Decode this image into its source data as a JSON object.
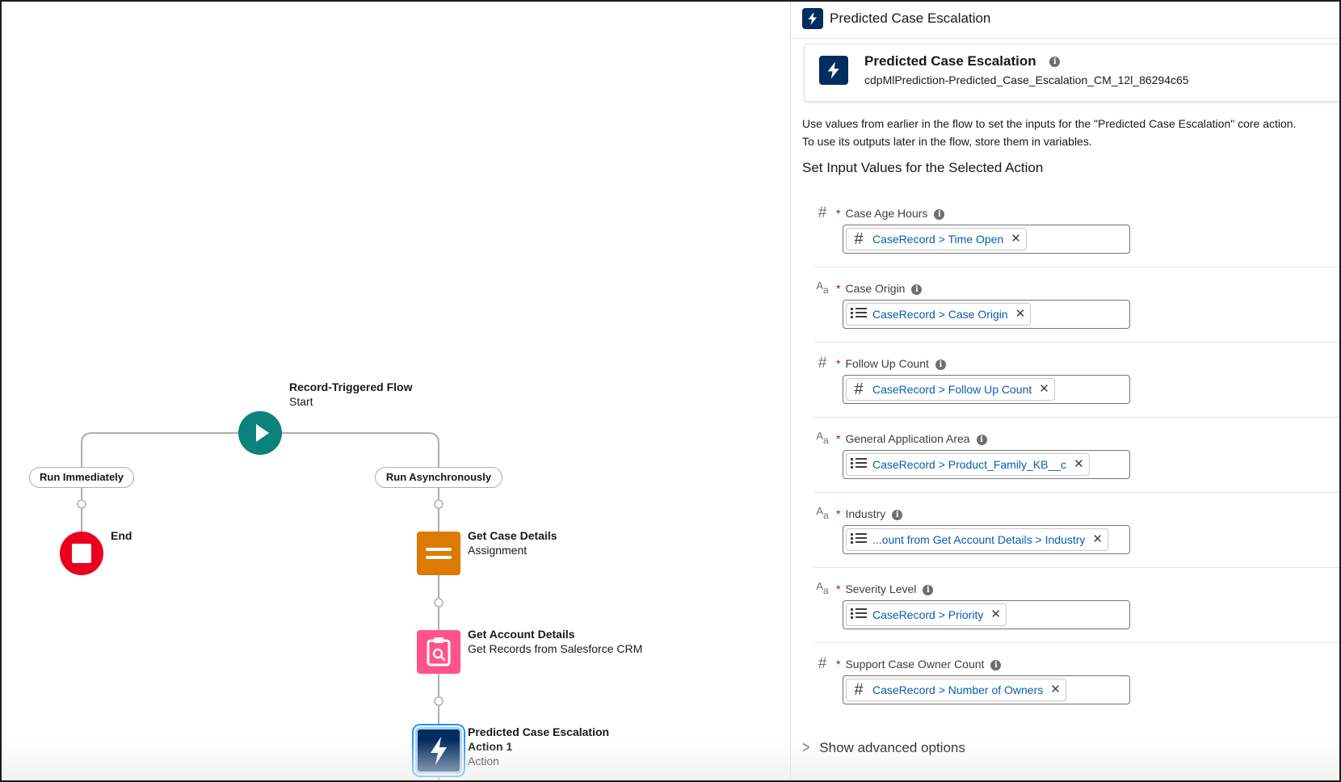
{
  "canvas": {
    "start": {
      "title": "Record-Triggered Flow",
      "subtitle": "Start"
    },
    "paths": {
      "left": "Run Immediately",
      "right": "Run Asynchronously"
    },
    "end": {
      "title": "End"
    },
    "assignment": {
      "title": "Get Case Details",
      "subtitle": "Assignment"
    },
    "get_records": {
      "title": "Get Account Details",
      "subtitle": "Get Records from Salesforce CRM"
    },
    "action": {
      "title_line1": "Predicted Case Escalation",
      "title_line2": "Action 1",
      "subtitle": "Action"
    }
  },
  "panel": {
    "header_title": "Predicted Case Escalation",
    "card": {
      "title": "Predicted Case Escalation",
      "api_name": "cdpMlPrediction-Predicted_Case_Escalation_CM_12l_86294c65"
    },
    "description_line1": "Use values from earlier in the flow to set the inputs for the \"Predicted Case Escalation\" core action.",
    "description_line2": "To use its outputs later in the flow, store them in variables.",
    "section_title": "Set Input Values for the Selected Action",
    "fields": [
      {
        "label": "Case Age Hours",
        "type_icon": "number-icon",
        "token_icon": "number-icon",
        "token": "CaseRecord > Time Open"
      },
      {
        "label": "Case Origin",
        "type_icon": "text-icon",
        "token_icon": "picklist-icon",
        "token": "CaseRecord > Case Origin"
      },
      {
        "label": "Follow Up Count",
        "type_icon": "number-icon",
        "token_icon": "number-icon",
        "token": "CaseRecord > Follow Up Count"
      },
      {
        "label": "General Application Area",
        "type_icon": "text-icon",
        "token_icon": "picklist-icon",
        "token": "CaseRecord > Product_Family_KB__c"
      },
      {
        "label": "Industry",
        "type_icon": "text-icon",
        "token_icon": "picklist-icon",
        "token": "...ount from Get Account Details > Industry"
      },
      {
        "label": "Severity Level",
        "type_icon": "text-icon",
        "token_icon": "picklist-icon",
        "token": "CaseRecord > Priority"
      },
      {
        "label": "Support Case Owner Count",
        "type_icon": "number-icon",
        "token_icon": "number-icon",
        "token": "CaseRecord > Number of Owners"
      }
    ],
    "required_marker": "*",
    "advanced_label": "Show advanced options"
  },
  "colors": {
    "start_node": "#0b827c",
    "end_node": "#ea001e",
    "assignment_node": "#dd7a01",
    "get_records_node": "#ff538a",
    "action_node": "#032d60",
    "token_link": "#0b5cab",
    "required": "#ba0517"
  }
}
